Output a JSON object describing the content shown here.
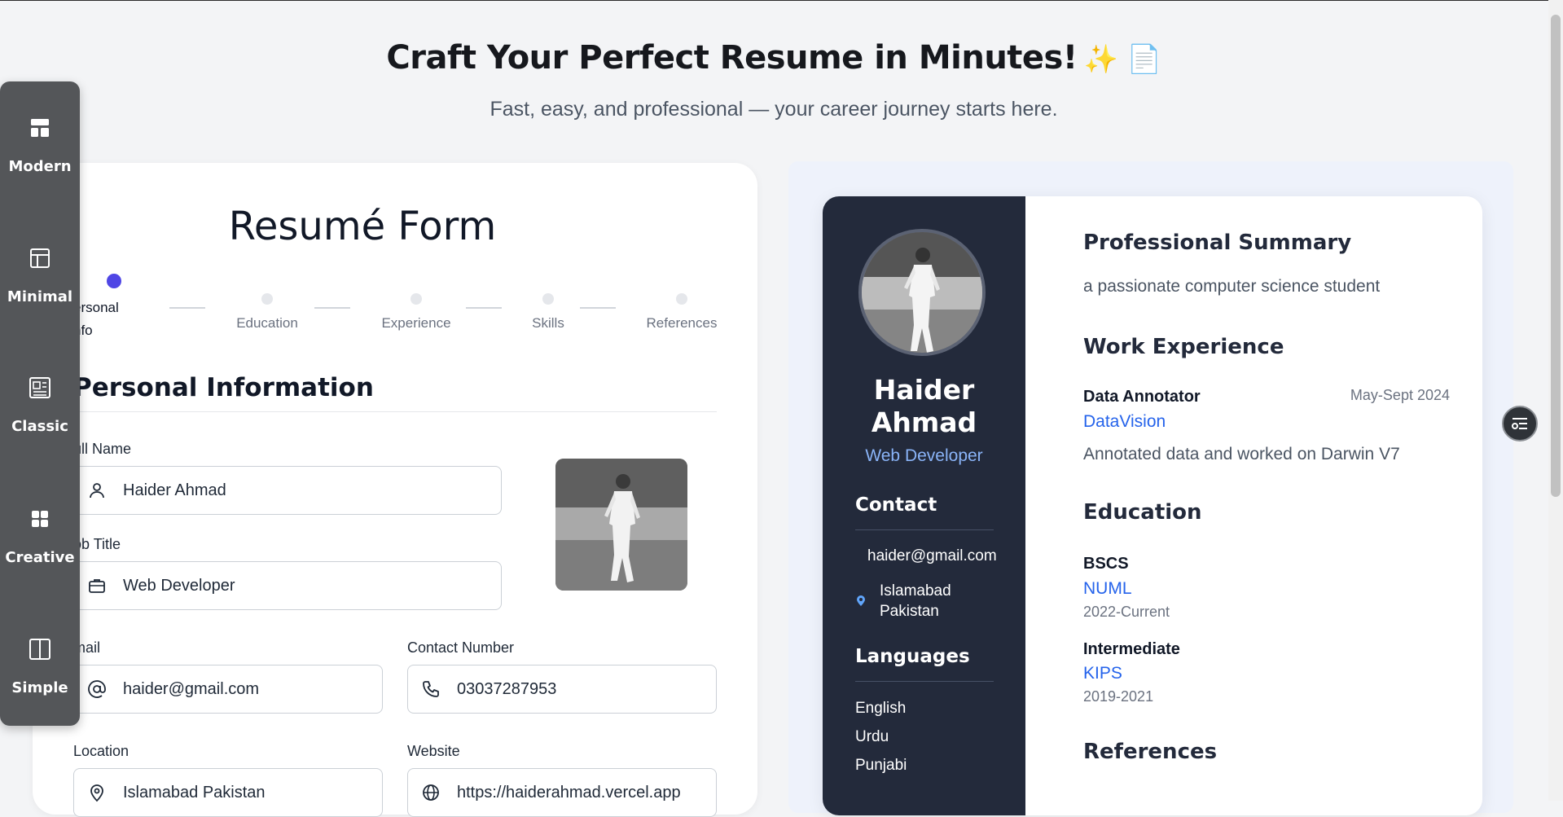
{
  "header": {
    "title": "Craft Your Perfect Resume in Minutes!",
    "title_emojis": "✨ 📄",
    "subtitle": "Fast, easy, and professional — your career journey starts here."
  },
  "sidebar": {
    "items": [
      {
        "label": "Modern",
        "icon": "layout-modern-icon"
      },
      {
        "label": "Minimal",
        "icon": "layout-minimal-icon"
      },
      {
        "label": "Classic",
        "icon": "layout-classic-icon"
      },
      {
        "label": "Creative",
        "icon": "layout-creative-icon"
      },
      {
        "label": "Simple",
        "icon": "layout-simple-icon"
      }
    ]
  },
  "form": {
    "title": "Resumé Form",
    "steps": [
      {
        "label_line1": "ersonal",
        "label_line2": "nfo",
        "active": true
      },
      {
        "label": "Education"
      },
      {
        "label": "Experience"
      },
      {
        "label": "Skills"
      },
      {
        "label": "References"
      }
    ],
    "section_title": "Personal Information",
    "fields": {
      "full_name": {
        "label": "ull Name",
        "value": "Haider Ahmad"
      },
      "job_title": {
        "label": "ob Title",
        "value": "Web Developer"
      },
      "email": {
        "label": "mail",
        "value": "haider@gmail.com"
      },
      "contact": {
        "label": "Contact Number",
        "value": "03037287953"
      },
      "location": {
        "label": "Location",
        "value": "Islamabad Pakistan"
      },
      "website": {
        "label": "Website",
        "value": "https://haiderahmad.vercel.app"
      }
    }
  },
  "resume": {
    "name": "Haider Ahmad",
    "job_title": "Web Developer",
    "contact_heading": "Contact",
    "email": "haider@gmail.com",
    "location_line1": "Islamabad",
    "location_line2": "Pakistan",
    "languages_heading": "Languages",
    "languages": [
      "English",
      "Urdu",
      "Punjabi"
    ],
    "summary_heading": "Professional Summary",
    "summary": "a passionate computer science student",
    "work_heading": "Work Experience",
    "work": {
      "role": "Data Annotator",
      "dates": "May-Sept 2024",
      "company": "DataVision",
      "description": "Annotated data and worked on Darwin V7"
    },
    "education_heading": "Education",
    "education": [
      {
        "degree": "BSCS",
        "school": "NUML",
        "years": "2022-Current"
      },
      {
        "degree": "Intermediate",
        "school": "KIPS",
        "years": "2019-2021"
      }
    ],
    "references_heading": "References"
  },
  "colors": {
    "accent": "#4f46e5",
    "sidebar": "#545659",
    "resume_side": "#232a3b",
    "link": "#2563eb"
  }
}
